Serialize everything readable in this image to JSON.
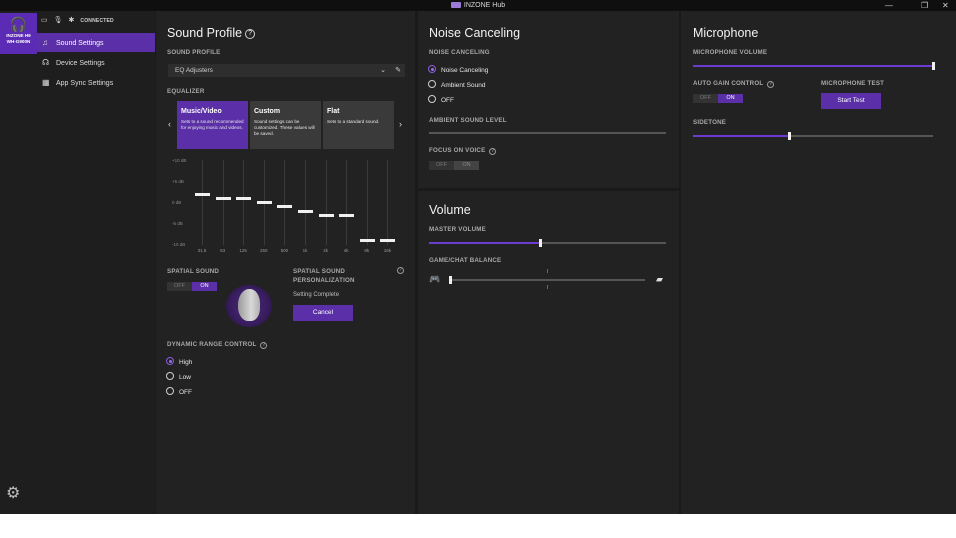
{
  "window": {
    "title": "INZONE Hub",
    "controls": [
      "—",
      "❐",
      "✕"
    ]
  },
  "device": {
    "name_line1": "INZONE H9",
    "name_line2": "WH-G900N",
    "status": "CONNECTED"
  },
  "sidebar": {
    "items": [
      {
        "label": "Sound Settings",
        "active": true
      },
      {
        "label": "Device Settings",
        "active": false
      },
      {
        "label": "App Sync Settings",
        "active": false
      }
    ]
  },
  "sound_profile": {
    "title": "Sound Profile",
    "profile_label": "SOUND PROFILE",
    "profile_value": "EQ Adjusters",
    "equalizer_label": "EQUALIZER",
    "presets": [
      {
        "title": "Music/Video",
        "desc": "Sets to a sound recommended for enjoying music and videos.",
        "selected": true
      },
      {
        "title": "Custom",
        "desc": "Sound settings can be customized. These values will be saved.",
        "selected": false
      },
      {
        "title": "Flat",
        "desc": "Sets to a standard sound.",
        "selected": false
      }
    ],
    "eq_db_labels": [
      "+10 dB",
      "+5 dB",
      "0 dB",
      "-5 dB",
      "-10 dB"
    ],
    "eq_bands": [
      "31.5",
      "63",
      "125",
      "250",
      "500",
      "1k",
      "2k",
      "4k",
      "8k",
      "16k"
    ],
    "eq_values_db": [
      2,
      1,
      1,
      0,
      -1,
      -2,
      -3,
      -3,
      -9,
      -9
    ],
    "spatial_label": "SPATIAL SOUND",
    "spatial_toggle": {
      "off": "OFF",
      "on": "ON"
    },
    "personalization_label_1": "SPATIAL SOUND",
    "personalization_label_2": "PERSONALIZATION",
    "setting_status": "Setting Complete",
    "cancel_label": "Cancel",
    "drc_label": "DYNAMIC RANGE CONTROL",
    "drc_options": [
      {
        "label": "High",
        "selected": true
      },
      {
        "label": "Low",
        "selected": false
      },
      {
        "label": "OFF",
        "selected": false
      }
    ]
  },
  "noise": {
    "title": "Noise Canceling",
    "label": "NOISE CANCELING",
    "options": [
      {
        "label": "Noise Canceling",
        "selected": true
      },
      {
        "label": "Ambient Sound",
        "selected": false
      },
      {
        "label": "OFF",
        "selected": false
      }
    ],
    "ambient_label": "AMBIENT SOUND LEVEL",
    "focus_label": "FOCUS ON VOICE",
    "focus_toggle": {
      "off": "OFF",
      "on": "ON"
    }
  },
  "volume": {
    "title": "Volume",
    "master_label": "MASTER VOLUME",
    "master_level": 0.47,
    "balance_label": "GAME/CHAT BALANCE",
    "balance_level": 0.0
  },
  "microphone": {
    "title": "Microphone",
    "volume_label": "MICROPHONE VOLUME",
    "volume_level": 1.0,
    "agc_label": "AUTO GAIN CONTROL",
    "agc_toggle": {
      "off": "OFF",
      "on": "ON"
    },
    "test_label": "MICROPHONE TEST",
    "start_test": "Start Test",
    "sidetone_label": "SIDETONE",
    "sidetone_level": 0.4
  }
}
